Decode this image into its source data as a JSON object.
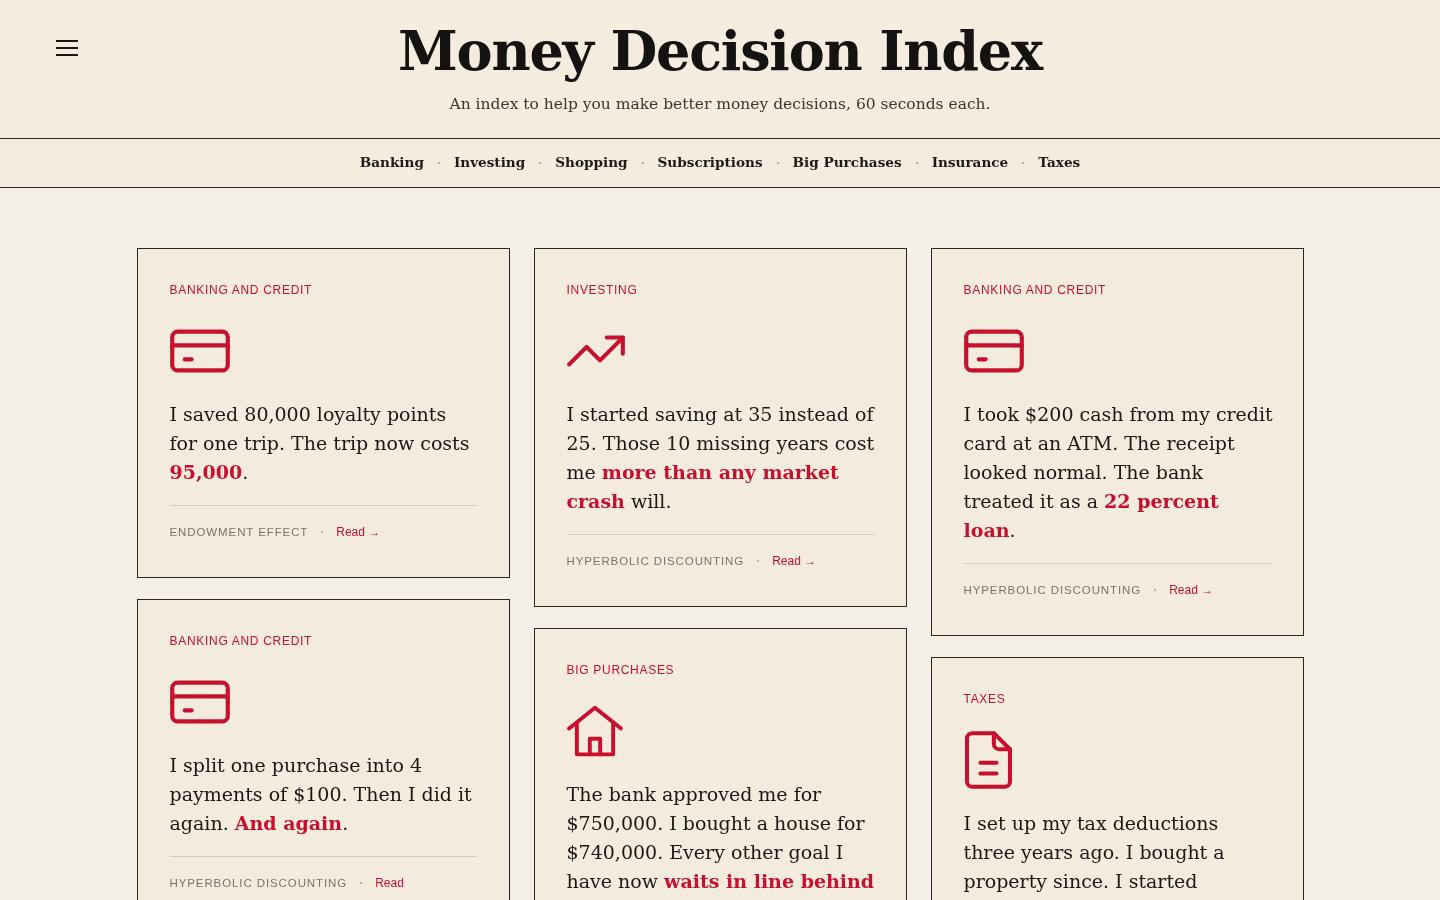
{
  "header": {
    "title": "Money Decision Index",
    "subtitle": "An index to help you make better money decisions, 60 seconds each."
  },
  "nav": {
    "items": [
      "Banking",
      "Investing",
      "Shopping",
      "Subscriptions",
      "Big Purchases",
      "Insurance",
      "Taxes"
    ]
  },
  "cards": [
    {
      "kind": "card",
      "category": "BANKING AND CREDIT",
      "text": "I saved 80,000 loyalty points for one trip. The trip now costs **95,000**.",
      "topic": "ENDOWMENT EFFECT",
      "link": "Read →"
    },
    {
      "kind": "trend",
      "category": "INVESTING",
      "text": "I started saving at 35 instead of 25. Those 10 missing years cost me **more than any market crash** will.",
      "topic": "HYPERBOLIC DISCOUNTING",
      "link": "Read →"
    },
    {
      "kind": "card",
      "category": "BANKING AND CREDIT",
      "text": "I took $200 cash from my credit card at an ATM. The receipt looked normal. The bank treated it as a **22 percent loan**.",
      "topic": "HYPERBOLIC DISCOUNTING",
      "link": "Read →"
    },
    {
      "kind": "card",
      "category": "BANKING AND CREDIT",
      "text": "I split one purchase into 4 payments of $100. Then I did it again. **And again**.",
      "topic": "HYPERBOLIC DISCOUNTING",
      "link": "Read"
    },
    {
      "kind": "house",
      "category": "BIG PURCHASES",
      "text": "The bank approved me for $750,000. I bought a house for $740,000. Every other goal I have now **waits in line behind**"
    },
    {
      "kind": "document",
      "category": "TAXES",
      "text": "I set up my tax deductions three years ago. I bought a property since. I started"
    }
  ]
}
